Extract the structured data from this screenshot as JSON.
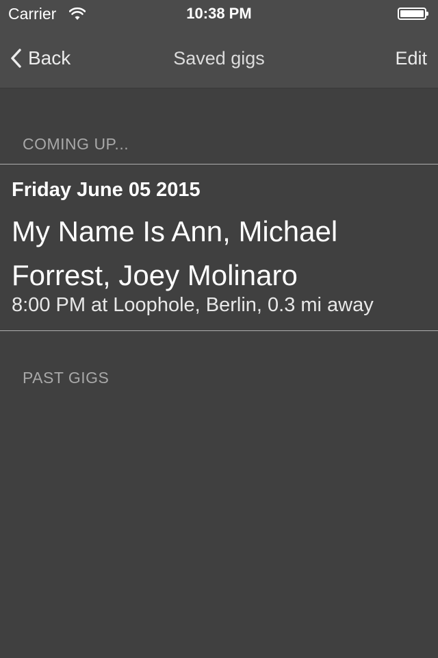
{
  "status_bar": {
    "carrier": "Carrier",
    "time": "10:38 PM"
  },
  "nav_bar": {
    "back_label": "Back",
    "title": "Saved gigs",
    "edit_label": "Edit"
  },
  "sections": {
    "upcoming": {
      "header": "COMING UP...",
      "gigs": [
        {
          "date": "Friday June 05 2015",
          "artists": "My Name Is Ann, Michael Forrest, Joey Molinaro",
          "details": "8:00 PM at Loophole, Berlin, 0.3 mi away"
        }
      ]
    },
    "past": {
      "header": "PAST GIGS"
    }
  },
  "colors": {
    "background": "#404040",
    "bar": "#4b4b4b",
    "section_header": "#a8a8a8",
    "separator": "#b0b0b0"
  }
}
